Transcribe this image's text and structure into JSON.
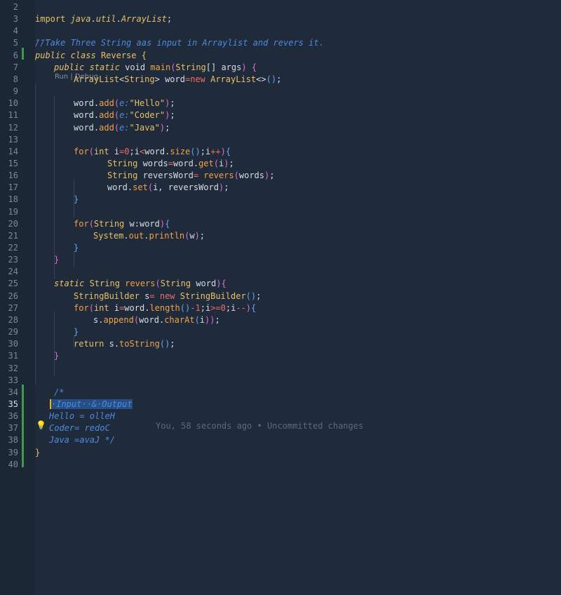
{
  "editor": {
    "codelens": {
      "run": "Run",
      "sep": " | ",
      "debug": "Debug"
    },
    "blame": "You, 58 seconds ago • Uncommitted changes",
    "fold_marker": "···",
    "lightbulb": "💡",
    "line_numbers": [
      "2",
      "3",
      "4",
      "5",
      "6",
      "7",
      "8",
      "9",
      "10",
      "11",
      "12",
      "13",
      "14",
      "15",
      "16",
      "17",
      "18",
      "19",
      "20",
      "21",
      "22",
      "23",
      "24",
      "25",
      "26",
      "27",
      "28",
      "29",
      "30",
      "31",
      "32",
      "33",
      "34",
      "35",
      "36",
      "37",
      "38",
      "39",
      "40"
    ],
    "lines": {
      "l3": [
        "import ",
        "java",
        ".",
        "util",
        ".",
        "ArrayList",
        ";"
      ],
      "l5": [
        "//Take Three String aas input in Arraylist and revers it."
      ],
      "l6": [
        "public ",
        "class ",
        "Reverse ",
        "{"
      ],
      "l7": [
        "public ",
        "static ",
        "void ",
        "main",
        "(",
        "String",
        "[] args",
        ")",
        " {"
      ],
      "l8": [
        "ArrayList",
        "<",
        "String",
        "> word",
        "=",
        "new ",
        "ArrayList",
        "<>",
        "()",
        ";"
      ],
      "l10": [
        "word",
        ".",
        "add",
        "(",
        "e:",
        "\"Hello\"",
        ")",
        ";"
      ],
      "l11": [
        "word",
        ".",
        "add",
        "(",
        "e:",
        "\"Coder\"",
        ")",
        ";"
      ],
      "l12": [
        "word",
        ".",
        "add",
        "(",
        "e:",
        "\"Java\"",
        ")",
        ";"
      ],
      "l14": [
        "for",
        "(",
        "int ",
        "i",
        "=",
        "0",
        ";",
        "i",
        "<",
        "word",
        ".",
        "size",
        "()",
        ";",
        "i",
        "++",
        ")",
        "{"
      ],
      "l15": [
        "String ",
        "words",
        "=",
        "word",
        ".",
        "get",
        "(",
        "i",
        ")",
        ";"
      ],
      "l16": [
        "String ",
        "reversWord",
        "= ",
        "revers",
        "(",
        "words",
        ")",
        ";"
      ],
      "l17": [
        "word",
        ".",
        "set",
        "(",
        "i, reversWord",
        ")",
        ";"
      ],
      "l18": [
        "}"
      ],
      "l20": [
        "for",
        "(",
        "String ",
        "w",
        ":",
        "word",
        ")",
        "{"
      ],
      "l21": [
        "System",
        ".",
        "out",
        ".",
        "println",
        "(",
        "w",
        ")",
        ";"
      ],
      "l22": [
        "}"
      ],
      "l23": [
        "}"
      ],
      "l25": [
        "static ",
        "String ",
        "revers",
        "(",
        "String ",
        "word",
        ")",
        "{"
      ],
      "l26": [
        "StringBuilder ",
        "s",
        "= ",
        "new ",
        "StringBuilder",
        "()",
        ";"
      ],
      "l27": [
        "for",
        "(",
        "int ",
        "i",
        "=",
        "word",
        ".",
        "length",
        "()",
        "-",
        "1",
        ";",
        "i",
        ">=",
        "0",
        ";",
        "i",
        "--",
        ")",
        "{"
      ],
      "l28": [
        "s",
        ".",
        "append",
        "(",
        "word",
        ".",
        "charAt",
        "(",
        "i",
        "))",
        ";"
      ],
      "l29": [
        "}"
      ],
      "l30": [
        "return ",
        "s",
        ".",
        "toString",
        "()",
        ";"
      ],
      "l31": [
        "}"
      ],
      "l34": [
        "/*"
      ],
      "l35": [
        "·Input··&·Output"
      ],
      "l36": [
        "Hello = olleH"
      ],
      "l37": [
        "Coder= redoC"
      ],
      "l38": [
        "Java =avaJ */"
      ],
      "l39": [
        "}"
      ]
    }
  }
}
